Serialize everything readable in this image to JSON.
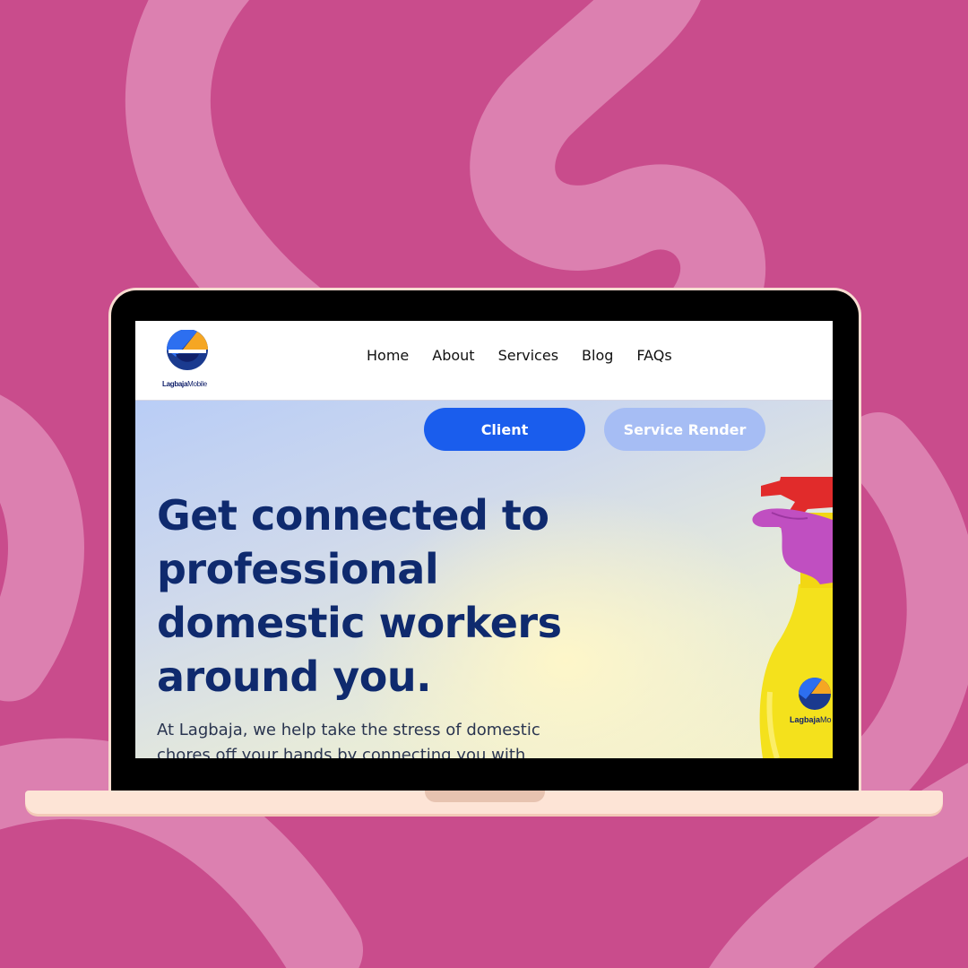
{
  "site": {
    "logo": {
      "brand": "Lagbaja",
      "suffix": "Mobile"
    },
    "nav": [
      "Home",
      "About",
      "Services",
      "Blog",
      "FAQs"
    ]
  },
  "hero": {
    "buttons": {
      "client": "Client",
      "service_render": "Service Render"
    },
    "title": "Get connected to professional domestic workers around you.",
    "text": "At Lagbaja, we help take the stress of domestic chores off your hands by connecting you with",
    "bottle_label": {
      "brand": "Lagbaja",
      "suffix": "Mo"
    }
  },
  "colors": {
    "background": "#c94c8c",
    "swirl": "#dc80b0",
    "primary_button": "#1a5ded",
    "secondary_button": "#a6bdf4",
    "heading": "#0f2a6e",
    "laptop_frame": "#fde4d6"
  }
}
